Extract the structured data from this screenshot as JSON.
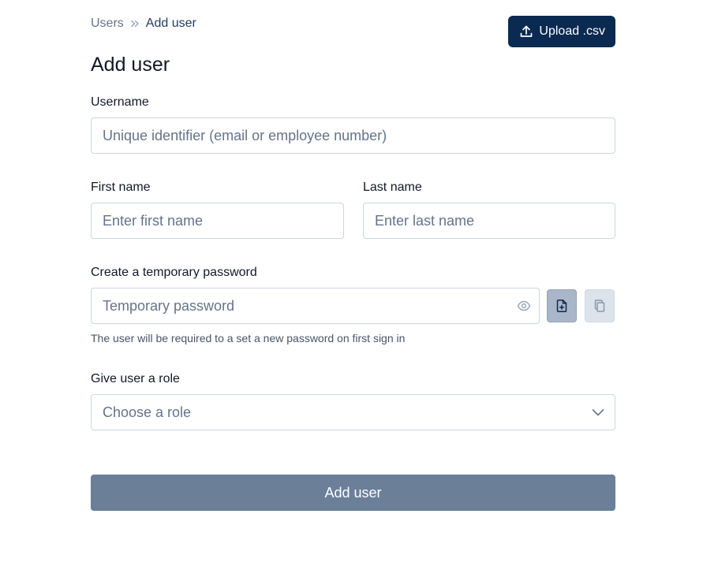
{
  "breadcrumb": {
    "root": "Users",
    "current": "Add user"
  },
  "header": {
    "upload_label": "Upload .csv"
  },
  "page": {
    "title": "Add user"
  },
  "form": {
    "username": {
      "label": "Username",
      "placeholder": "Unique identifier (email or employee number)",
      "value": ""
    },
    "first_name": {
      "label": "First name",
      "placeholder": "Enter first name",
      "value": ""
    },
    "last_name": {
      "label": "Last name",
      "placeholder": "Enter last name",
      "value": ""
    },
    "password": {
      "label": "Create a temporary password",
      "placeholder": "Temporary password",
      "value": "",
      "helper": "The user will be required to a set a new password on first sign in"
    },
    "role": {
      "label": "Give user a role",
      "selected": "Choose a role"
    },
    "submit_label": "Add user"
  },
  "icons": {
    "breadcrumb_separator": "chevrons-right-icon",
    "upload": "upload-icon",
    "show_password": "eye-icon",
    "generate_password": "file-plus-icon",
    "copy_password": "copy-icon",
    "role_dropdown": "chevron-down-icon"
  },
  "colors": {
    "primary_button": "#0b2a52",
    "submit_button_disabled": "#6b7f99",
    "input_border": "#cbd5e1",
    "placeholder_text": "#64748b"
  }
}
